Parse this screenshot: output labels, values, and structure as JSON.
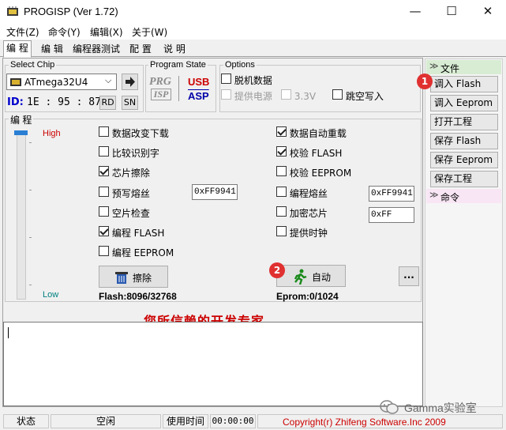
{
  "window": {
    "title": "PROGISP (Ver 1.72)",
    "minimize": "—",
    "maximize": "☐",
    "close": "✕"
  },
  "menu": [
    "文件(Z)",
    "命令(Y)",
    "编辑(X)",
    "关于(W)"
  ],
  "tabs": [
    "编 程",
    "编 辑",
    "编程器测试",
    "配 置",
    "说 明"
  ],
  "chip": {
    "group_label": "Select Chip",
    "selected": "ATmega32U4",
    "id_label": "ID:",
    "id_value": "1E : 95 : 87",
    "rd": "RD",
    "sn": "SN"
  },
  "program_state": {
    "label": "Program State",
    "prg": "PRG",
    "isp": "ISP",
    "usb": "USB",
    "asp": "ASP"
  },
  "options": {
    "label": "Options",
    "offline": "脱机数据",
    "power": "提供电源",
    "v33": "3.3V",
    "skip": "跳空写入"
  },
  "program": {
    "label": "编 程",
    "high": "High",
    "low": "Low",
    "left": [
      {
        "label": "数据改变下载",
        "checked": false
      },
      {
        "label": "比较识别字",
        "checked": false
      },
      {
        "label": "芯片擦除",
        "checked": true
      },
      {
        "label": "预写熔丝",
        "checked": false
      },
      {
        "label": "空片检查",
        "checked": false
      },
      {
        "label": "编程 FLASH",
        "checked": true
      },
      {
        "label": "编程 EEPROM",
        "checked": false
      }
    ],
    "right": [
      {
        "label": "数据自动重载",
        "checked": true
      },
      {
        "label": "校验 FLASH",
        "checked": true
      },
      {
        "label": "校验 EEPROM",
        "checked": false
      },
      {
        "label": "编程熔丝",
        "checked": false
      },
      {
        "label": "加密芯片",
        "checked": false
      },
      {
        "label": "提供时钟",
        "checked": false
      }
    ],
    "fuse_pre": "0xFF9941",
    "fuse_prog": "0xFF9941",
    "lock": "0xFF",
    "erase": "擦除",
    "auto": "自动",
    "more": "...",
    "flash": "Flash:8096/32768",
    "eprom": "Eprom:0/1024"
  },
  "slogan": "您所信赖的开发专家",
  "sidebar": {
    "file_header": "文件",
    "buttons": [
      "调入 Flash",
      "调入 Eeprom",
      "打开工程",
      "保存 Flash",
      "保存 Eeprom",
      "保存工程"
    ],
    "cmd_header": "命令"
  },
  "badges": [
    "1",
    "2"
  ],
  "status": {
    "state_label": "状态",
    "state_value": "空闲",
    "time_label": "使用时间",
    "time_value": "00:00:00",
    "copyright": "Copyright(r) Zhifeng Software.Inc 2009"
  },
  "watermark": "Gamma实验室",
  "colors": {
    "red": "#cc0000",
    "blue": "#0000cc",
    "accent": "#2a7fd4"
  }
}
